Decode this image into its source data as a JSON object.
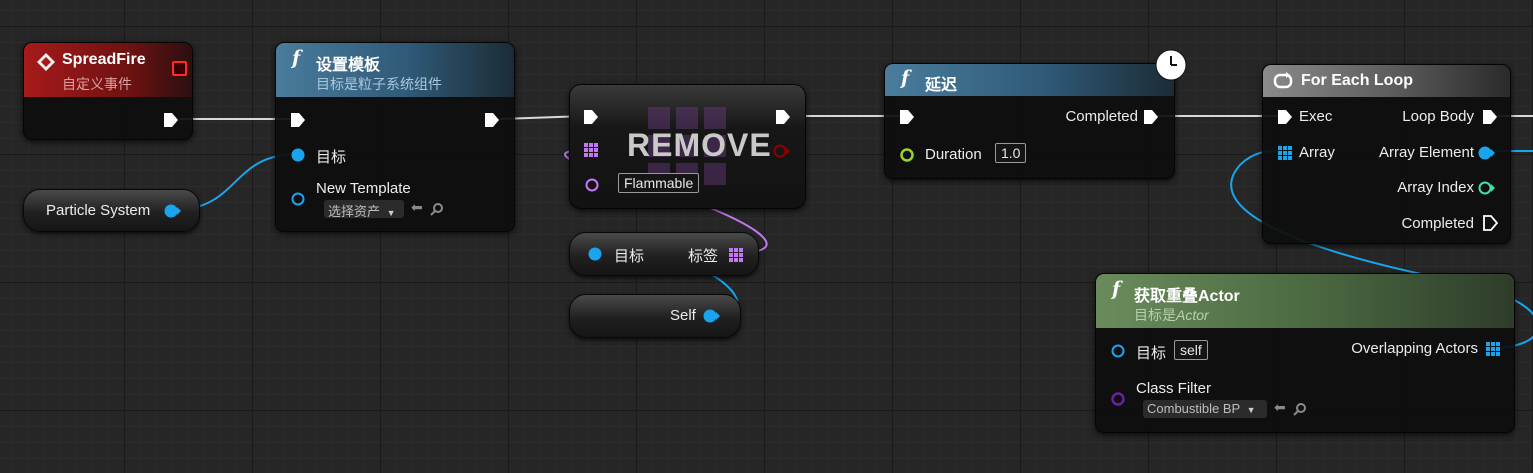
{
  "event_node": {
    "title": "SpreadFire",
    "subtitle": "自定义事件"
  },
  "particle_var": {
    "label": "Particle System"
  },
  "set_template": {
    "title": "设置模板",
    "subtitle": "目标是粒子系统组件",
    "target_label": "目标",
    "template_label": "New Template",
    "asset_picker": "选择资产"
  },
  "remove_node": {
    "title": "REMOVE",
    "tag_value": "Flammable"
  },
  "tags_node": {
    "target_label": "目标",
    "tags_label": "标签"
  },
  "self_node": {
    "label": "Self"
  },
  "delay_node": {
    "title": "延迟",
    "completed_label": "Completed",
    "duration_label": "Duration",
    "duration_value": "1.0"
  },
  "foreach_node": {
    "title": "For Each Loop",
    "exec_label": "Exec",
    "array_label": "Array",
    "loop_body_label": "Loop Body",
    "array_element_label": "Array Element",
    "array_index_label": "Array Index",
    "completed_label": "Completed"
  },
  "overlap_node": {
    "title": "获取重叠Actor",
    "subtitle_prefix": "目标是",
    "subtitle_class": "Actor",
    "target_label": "目标",
    "target_value": "self",
    "overlapping_label": "Overlapping Actors",
    "class_filter_label": "Class Filter",
    "class_filter_value": "Combustible BP"
  },
  "colors": {
    "exec": "#ffffff",
    "object_pin": "#1aa4ee",
    "tag_pin": "#c278f2",
    "float_pin": "#9ad42b",
    "int_pin": "#3fe0b0",
    "class_pin": "#6a1fa8",
    "event_header": "#8e1414",
    "function_header": "#3b6a8a",
    "pure_function_header": "#4f6b45"
  }
}
